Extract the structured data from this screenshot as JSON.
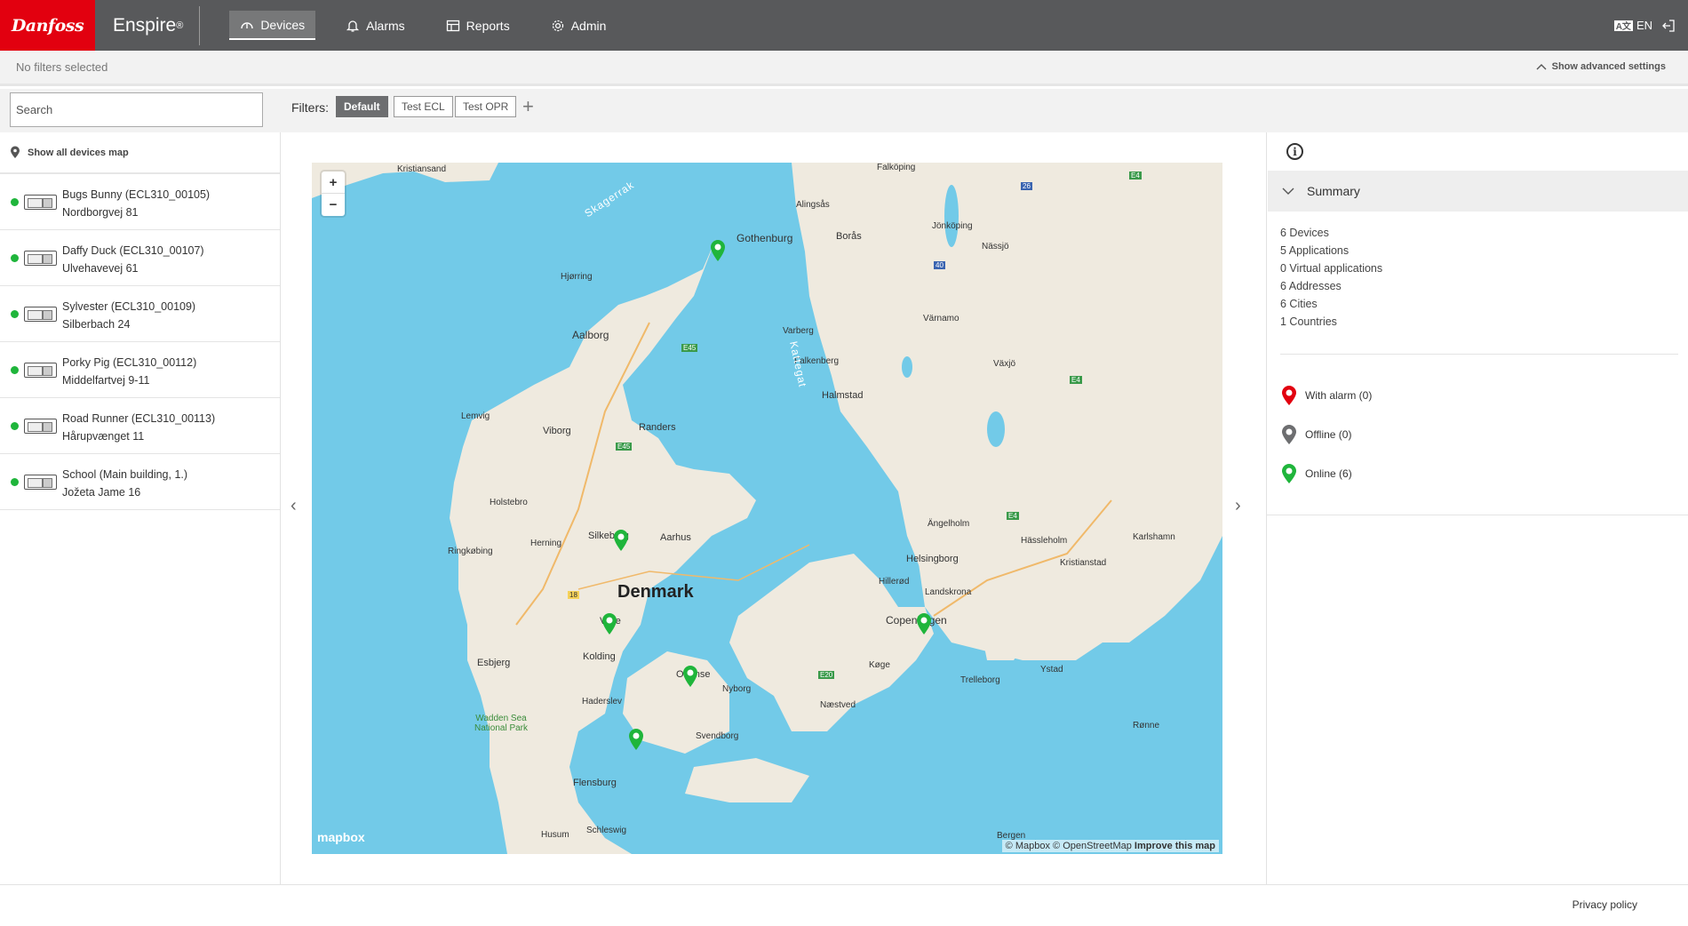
{
  "brand": {
    "logo_text": "Danfoss",
    "app_name": "Enspire",
    "app_mark": "®"
  },
  "nav": [
    {
      "label": "Devices",
      "icon": "gauge-icon",
      "active": true
    },
    {
      "label": "Alarms",
      "icon": "bell-icon",
      "active": false
    },
    {
      "label": "Reports",
      "icon": "table-icon",
      "active": false
    },
    {
      "label": "Admin",
      "icon": "gear-icon",
      "active": false
    }
  ],
  "topright": {
    "lang_icon": "A文",
    "lang": "EN"
  },
  "filterbar": {
    "status": "No filters selected",
    "advanced": "Show advanced settings"
  },
  "search": {
    "placeholder": "Search"
  },
  "filters": {
    "label": "Filters:",
    "chips": [
      "Default",
      "Test ECL",
      "Test OPR"
    ]
  },
  "sidebar": {
    "show_map": "Show all devices map",
    "devices": [
      {
        "name": "Bugs Bunny (ECL310_00105)",
        "address": "Nordborgvej 81"
      },
      {
        "name": "Daffy Duck (ECL310_00107)",
        "address": "Ulvehavevej 61"
      },
      {
        "name": "Sylvester (ECL310_00109)",
        "address": "Silberbach 24"
      },
      {
        "name": "Porky Pig (ECL310_00112)",
        "address": "Middelfartvej 9-11"
      },
      {
        "name": "Road Runner (ECL310_00113)",
        "address": "Hårupvænget 11"
      },
      {
        "name": "School (Main building, 1.)",
        "address": "Jožeta Jame 16"
      }
    ]
  },
  "map": {
    "zoom_in": "+",
    "zoom_out": "−",
    "country": "Denmark",
    "sea_labels": [
      "Skagerrak",
      "Kattegat"
    ],
    "place_labels": [
      "Kristiansand",
      "Falköping",
      "Alingsås",
      "Jönköping",
      "Gothenburg",
      "Borås",
      "Nässjö",
      "Hjørring",
      "Aalborg",
      "Värnamo",
      "Varberg",
      "Växjö",
      "Falkenberg",
      "Halmstad",
      "Lemvig",
      "Viborg",
      "Randers",
      "Holstebro",
      "Ängelholm",
      "Herning",
      "Silkeborg",
      "Aarhus",
      "Hässleholm",
      "Karlshamn",
      "Ringkøbing",
      "Helsingborg",
      "Kristianstad",
      "Hillerød",
      "Landskrona",
      "Vejle",
      "Copenhagen",
      "Esbjerg",
      "Kolding",
      "Odense",
      "Køge",
      "Trelleborg",
      "Ystad",
      "Nyborg",
      "Næstved",
      "Haderslev",
      "Wadden Sea National Park",
      "Svendborg",
      "Rønne",
      "Flensburg",
      "Husum",
      "Schleswig",
      "Bergen"
    ],
    "road_labels": [
      "E45",
      "E45",
      "E4",
      "E4",
      "E20",
      "18",
      "40",
      "26",
      "E4"
    ],
    "attribution": [
      "© Mapbox",
      "© OpenStreetMap",
      "Improve this map"
    ],
    "logo": "mapbox",
    "marker_color": "#1fb53b"
  },
  "summary": {
    "title": "Summary",
    "stats": [
      "6 Devices",
      "5 Applications",
      "0 Virtual applications",
      "6 Addresses",
      "6 Cities",
      "1 Countries"
    ],
    "legend": [
      {
        "label": "With alarm (0)",
        "color": "#e2000f"
      },
      {
        "label": "Offline (0)",
        "color": "#6d6e70"
      },
      {
        "label": "Online (6)",
        "color": "#1fb53b"
      }
    ]
  },
  "footer": {
    "privacy": "Privacy policy"
  }
}
